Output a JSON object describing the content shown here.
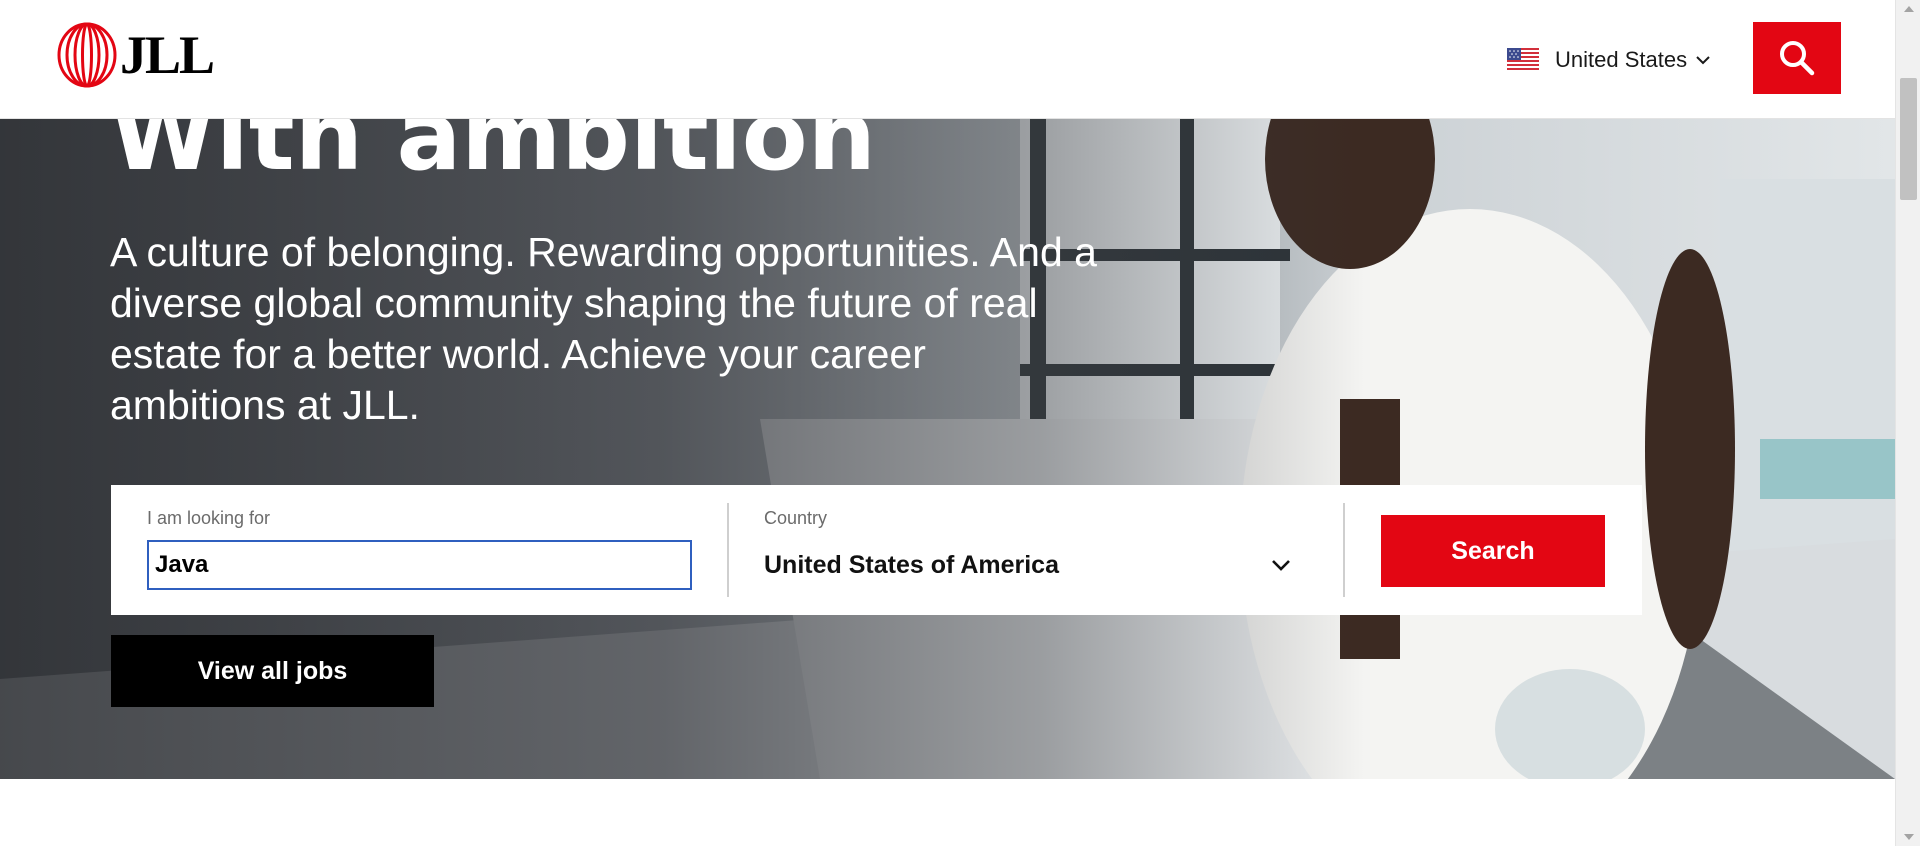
{
  "header": {
    "logo_text": "JLL",
    "country_selector": {
      "label": "United States",
      "flag_icon": "us-flag-icon",
      "chevron_icon": "chevron-down-icon"
    },
    "search_button_icon": "search-icon"
  },
  "hero": {
    "title": "With ambition",
    "description": "A culture of belonging. Rewarding opportunities. And a diverse global community shaping the future of real estate for a better world. Achieve your career ambitions at JLL."
  },
  "job_search": {
    "keyword": {
      "label": "I am looking for",
      "value": "Java"
    },
    "country": {
      "label": "Country",
      "value": "United States of America"
    },
    "search_button": "Search"
  },
  "view_all_jobs_button": "View all jobs",
  "colors": {
    "brand_red": "#e30613",
    "black": "#000000",
    "focus_blue": "#2f5fbf"
  }
}
